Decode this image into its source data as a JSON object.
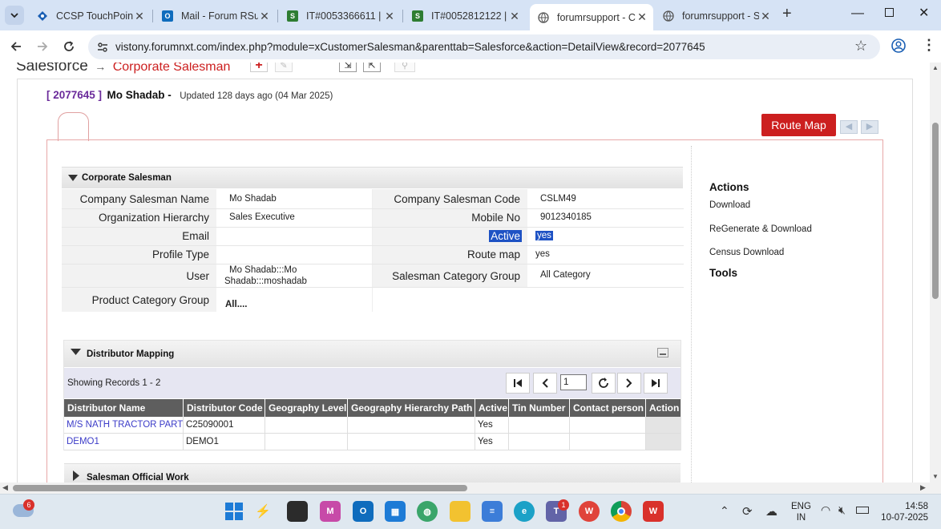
{
  "browser": {
    "tabs": [
      {
        "title": "CCSP TouchPoint -",
        "icon": "ccsp-icon",
        "color": "#1a5fb4"
      },
      {
        "title": "Mail - Forum RSup",
        "icon": "outlook-icon",
        "color": "#0f6cbd"
      },
      {
        "title": "IT#0053366611 | S",
        "icon": "s-icon",
        "color": "#2e7d32"
      },
      {
        "title": "IT#0052812122 | S",
        "icon": "s-icon",
        "color": "#2e7d32"
      },
      {
        "title": "forumrsupport - C",
        "icon": "globe-icon",
        "color": "#555555",
        "active": true
      },
      {
        "title": "forumrsupport - S",
        "icon": "globe-icon",
        "color": "#555555"
      }
    ],
    "new_tab": "+",
    "url": "vistony.forumnxt.com/index.php?module=xCustomerSalesman&parenttab=Salesforce&action=DetailView&record=2077645"
  },
  "page": {
    "breadcrumb_root": "Salesforce",
    "breadcrumb_arrow": "→",
    "breadcrumb_current": "Corporate Salesman",
    "record_id": "[ 2077645 ]",
    "record_name": "Mo Shadab -",
    "updated": "Updated 128 days ago (04 Mar 2025)",
    "route_map_button": "Route Map",
    "section_title": "Corporate Salesman",
    "fields_left": [
      {
        "label": "Company Salesman Name",
        "value": "Mo Shadab"
      },
      {
        "label": "Organization Hierarchy",
        "value": "Sales Executive"
      },
      {
        "label": "Email",
        "value": ""
      },
      {
        "label": "Profile Type",
        "value": ""
      },
      {
        "label": "User",
        "value": "Mo Shadab:::Mo Shadab:::moshadab"
      },
      {
        "label": "Product Category Group",
        "value": "All...."
      }
    ],
    "fields_right": [
      {
        "label": "Company Salesman Code",
        "value": "CSLM49"
      },
      {
        "label": "Mobile No",
        "value": "9012340185"
      },
      {
        "label": "Active",
        "value": "yes"
      },
      {
        "label": "Route map",
        "value": "yes"
      },
      {
        "label": "Salesman Category Group",
        "value": "All Category"
      }
    ],
    "actions": {
      "heading": "Actions",
      "items": [
        "Download",
        "ReGenerate & Download",
        "Census Download"
      ],
      "tools_heading": "Tools"
    },
    "distributor": {
      "title": "Distributor Mapping",
      "showing": "Showing Records 1 - 2",
      "page_value": "1",
      "columns": [
        "Distributor Name",
        "Distributor Code",
        "Geography Level",
        "Geography Hierarchy Path",
        "Active",
        "Tin Number",
        "Contact person",
        "Action"
      ],
      "rows": [
        {
          "name": "M/S NATH TRACTOR PART",
          "code": "C25090001",
          "geo_level": "",
          "geo_path": "",
          "active": "Yes",
          "tin": "",
          "contact": ""
        },
        {
          "name": "DEMO1",
          "code": "DEMO1",
          "geo_level": "",
          "geo_path": "",
          "active": "Yes",
          "tin": "",
          "contact": ""
        }
      ]
    },
    "official_work_title": "Salesman Official Work"
  },
  "taskbar": {
    "weather_badge": "6",
    "teams_badge": "1",
    "lang_top": "ENG",
    "lang_bottom": "IN",
    "time": "14:58",
    "date": "10-07-2025"
  },
  "colors": {
    "accent_red": "#cc1f1f",
    "link_purple": "#6a2a9a",
    "link_blue": "#3c3cc8",
    "header_dark": "#5e5e5e",
    "tab_bg": "#d6e3f5"
  }
}
